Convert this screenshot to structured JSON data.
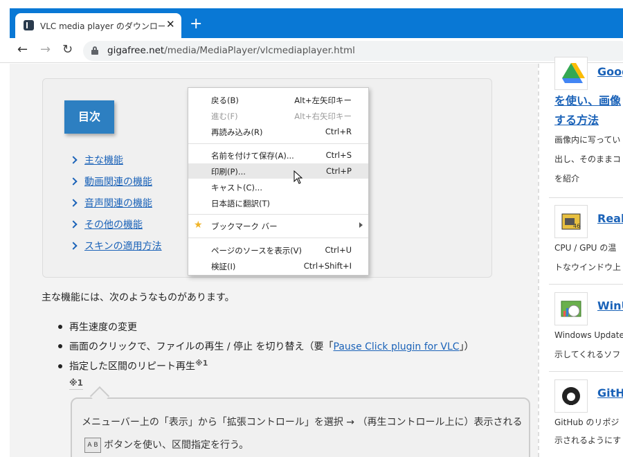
{
  "browser": {
    "tab_title": "VLC media player のダウンロード - I",
    "tab_close": "✕",
    "new_tab": "+",
    "url_host": "gigafree.net",
    "url_path": "/media/MediaPlayer/vlcmediaplayer.html",
    "back": "←",
    "forward": "→",
    "reload": "↻"
  },
  "toc": {
    "heading": "目次",
    "items": [
      "主な機能",
      "動画関連の機能",
      "音声関連の機能",
      "その他の機能",
      "スキンの適用方法"
    ]
  },
  "intro": "主な機能には、次のようなものがあります。",
  "features": {
    "item1": "再生速度の変更",
    "item2_before": "画面のクリックで、ファイルの再生 / 停止 を切り替え（要「",
    "item2_link": "Pause Click plugin for VLC",
    "item2_after": "」）",
    "item3": "指定した区間のリピート再生",
    "item3_note": "※1"
  },
  "note": {
    "label": "※1",
    "text_before": "メニューバー上の「表示」から「拡張コントロール」を選択 → （再生コントロール上に）表示される",
    "icon_text": "A B",
    "text_after": "ボタンを使い、区間指定を行う。"
  },
  "sidebar": {
    "entries": [
      {
        "title": "Goog",
        "subtitle": "を使い、画像",
        "subtitle2": "する方法",
        "desc": [
          "画像内に写ってい",
          "出し、そのままコ",
          "を紹介"
        ],
        "icon": "google-drive-icon"
      },
      {
        "title": "Real",
        "desc": [
          "CPU / GPU の温",
          "トなウインドウ上"
        ],
        "icon": "realtemp-icon"
      },
      {
        "title": "WinU",
        "desc": [
          "Windows Update",
          "示してくれるソフ"
        ],
        "icon": "winupdate-icon"
      },
      {
        "title": "GitH",
        "desc": [
          "GitHub のリポジ",
          "示されるようにす"
        ],
        "icon": "github-icon"
      }
    ]
  },
  "context_menu": {
    "items": [
      {
        "label": "戻る(B)",
        "shortcut": "Alt+左矢印キー",
        "disabled": false
      },
      {
        "label": "進む(F)",
        "shortcut": "Alt+右矢印キー",
        "disabled": true
      },
      {
        "label": "再読み込み(R)",
        "shortcut": "Ctrl+R",
        "disabled": false
      },
      {
        "label": "名前を付けて保存(A)...",
        "shortcut": "Ctrl+S",
        "disabled": false
      },
      {
        "label": "印刷(P)...",
        "shortcut": "Ctrl+P",
        "disabled": false,
        "hovered": true
      },
      {
        "label": "キャスト(C)...",
        "shortcut": "",
        "disabled": false
      },
      {
        "label": "日本語に翻訳(T)",
        "shortcut": "",
        "disabled": false
      },
      {
        "label": "ブックマーク バー",
        "shortcut": "",
        "disabled": false
      },
      {
        "label": "ページのソースを表示(V)",
        "shortcut": "Ctrl+U",
        "disabled": false
      },
      {
        "label": "検証(I)",
        "shortcut": "Ctrl+Shift+I",
        "disabled": false
      }
    ]
  },
  "colors": {
    "titlebar": "#0978d5",
    "link": "#1a62b8",
    "toc_heading_bg": "#2d7fc1"
  }
}
